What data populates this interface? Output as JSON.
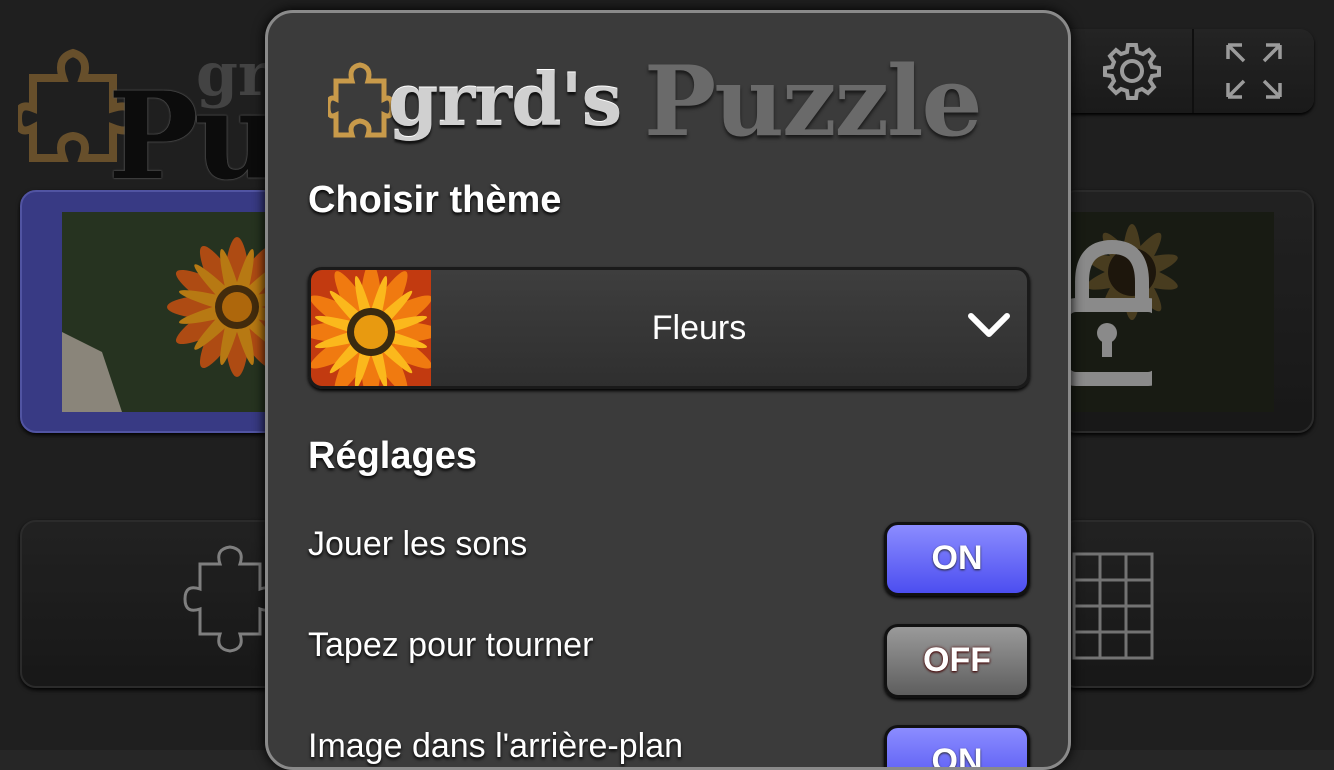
{
  "background": {
    "logo": {
      "small_text": "grrd's",
      "big_text": "Puzzle"
    },
    "top_buttons": [
      {
        "icon": "gear-icon"
      },
      {
        "icon": "fullscreen-icon"
      }
    ],
    "cards": [
      {
        "name": "Fleurs",
        "selected": true,
        "locked": false
      },
      {
        "name": "Sunflower",
        "selected": false,
        "locked": true
      },
      {
        "name": "single-piece",
        "icon": "puzzle-piece-icon"
      },
      {
        "name": "many-pieces",
        "icon": "puzzle-pieces-icon"
      }
    ]
  },
  "dialog": {
    "logo": {
      "text_small": "grrd's",
      "text_big": "Puzzle"
    },
    "theme_heading": "Choisir thème",
    "theme_select": {
      "value": "Fleurs",
      "icon": "chevron-down-icon"
    },
    "settings_heading": "Réglages",
    "settings": [
      {
        "label": "Jouer les sons",
        "state": "ON"
      },
      {
        "label": "Tapez pour tourner",
        "state": "OFF"
      },
      {
        "label": "Image dans l'arrière-plan",
        "state": "ON"
      }
    ]
  },
  "colors": {
    "toggle_on": "#5a5cf5",
    "toggle_off": "#7a7a7a",
    "selected_card": "#4b4eb0",
    "dialog_bg": "#3b3b3b"
  }
}
